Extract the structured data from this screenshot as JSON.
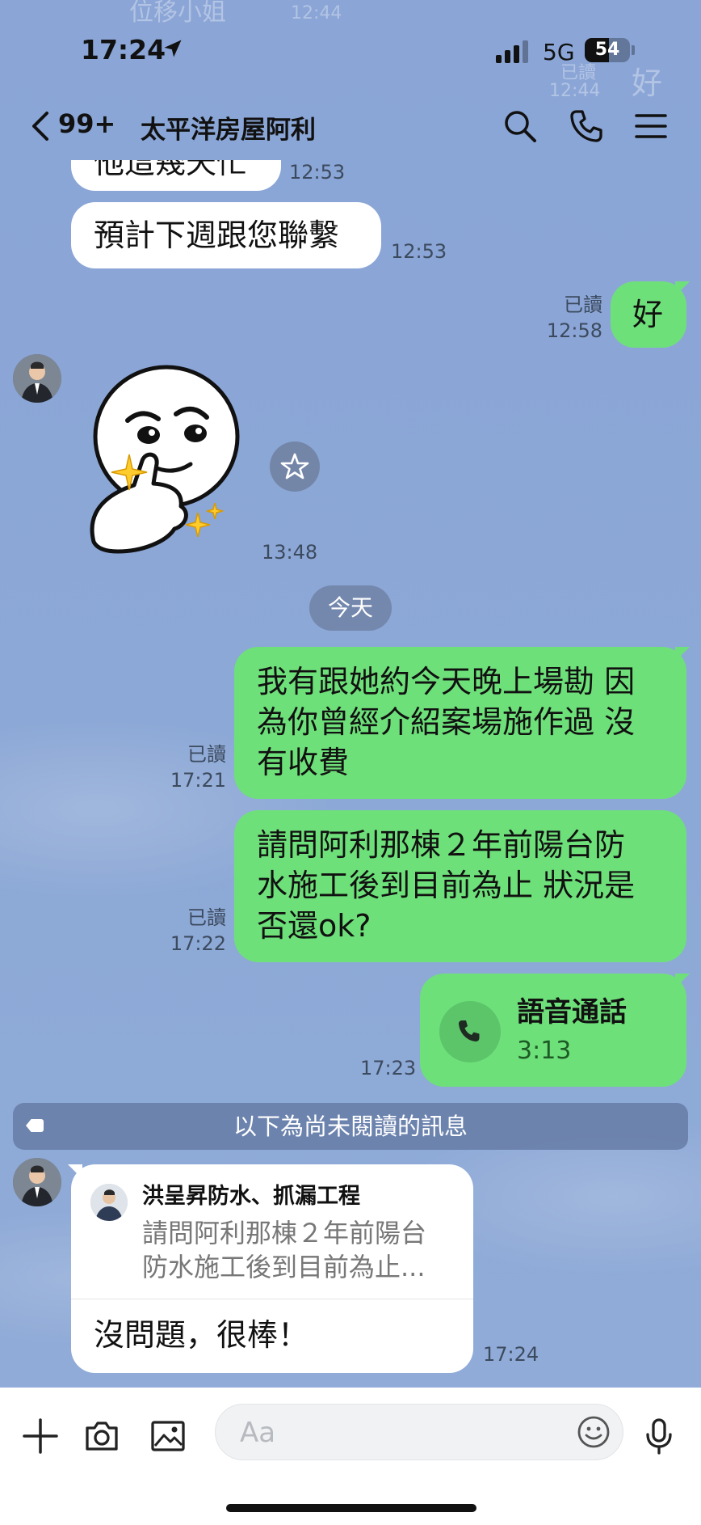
{
  "status_bar": {
    "time": "17:24",
    "network": "5G",
    "battery": "54",
    "battery_level": 0.54
  },
  "header": {
    "unread_count": "99+",
    "title": "太平洋房屋阿利"
  },
  "ghost_text": {
    "name_top": "位移小姐",
    "time_top": "12:44",
    "read_right": "已讀",
    "time_right": "12:44",
    "ok_right": "好"
  },
  "messages": {
    "m1": {
      "text": "他這幾天忙",
      "time": "12:53"
    },
    "m2": {
      "text": "預計下週跟您聯繫",
      "time": "12:53"
    },
    "m3": {
      "text": "好",
      "read": "已讀",
      "time": "12:58"
    },
    "m4": {
      "time": "13:48"
    },
    "m5": {
      "lines": [
        "我有跟她約今天晚上場勘 因",
        "為你曾經介紹案場施作過 沒",
        "有收費"
      ],
      "read": "已讀",
      "time": "17:21"
    },
    "m6": {
      "lines": [
        "請問阿利那棟２年前陽台防",
        "水施工後到目前為止 狀況是",
        "否還ok?"
      ],
      "read": "已讀",
      "time": "17:22"
    },
    "m7": {
      "title": "語音通話",
      "duration": "3:13",
      "time": "17:23"
    },
    "m8": {
      "quote_name": "洪呈昇防水、抓漏工程",
      "quote_lines": [
        "請問阿利那棟２年前陽台",
        "防水施工後到目前為止..."
      ],
      "text": "沒問題，很棒！",
      "time": "17:24"
    }
  },
  "date_chip": "今天",
  "unread_divider": "以下為尚未閱讀的訊息",
  "input": {
    "placeholder": "Aa"
  },
  "colors": {
    "background": "#8ba6d4",
    "sent_bubble": "#6ee07a",
    "received_bubble": "#ffffff",
    "call_icon_bg": "#5cc56a"
  }
}
